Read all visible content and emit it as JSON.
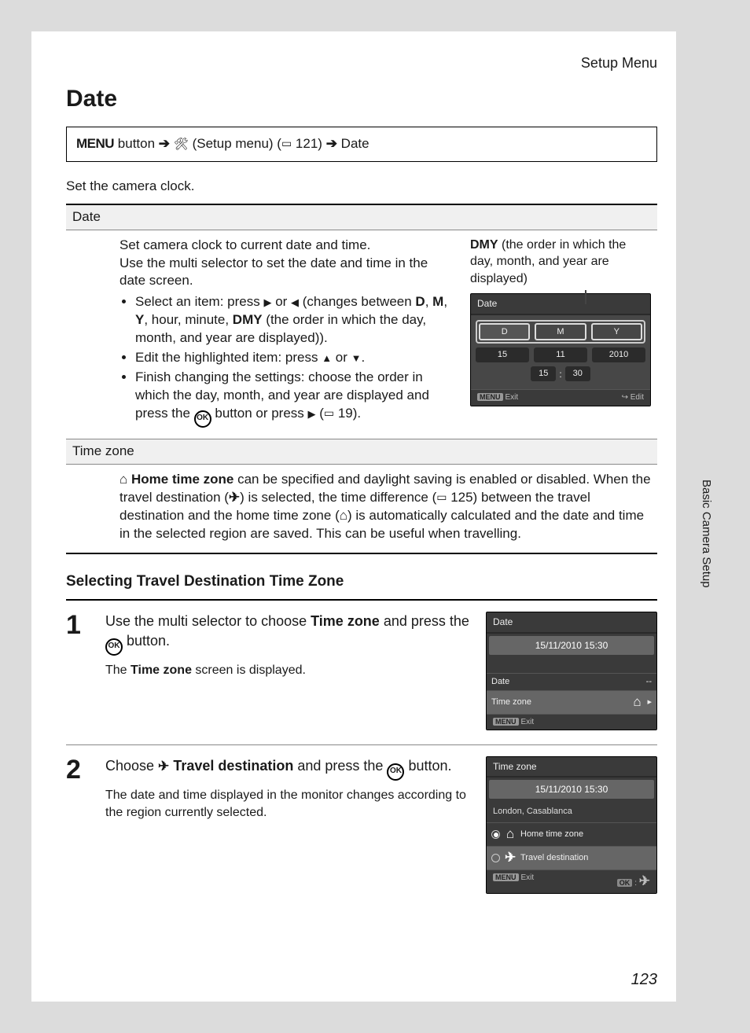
{
  "page": {
    "heading": "Setup Menu",
    "title": "Date",
    "sideTab": "Basic Camera Setup",
    "number": "123"
  },
  "breadcrumb": {
    "menu": "MENU",
    "b1": "button",
    "setup": "(Setup menu)",
    "ref": "121)",
    "end": "Date"
  },
  "intro": "Set the camera clock.",
  "row1": {
    "header": "Date",
    "p1": "Set camera clock to current date and time.",
    "p2": "Use the multi selector to set the date and time in the date screen.",
    "li1a": "Select an item: press ",
    "li1b": " or ",
    "li1c": " (changes between ",
    "li1d": ", ",
    "li1e": ", ",
    "li1f": ", hour, minute, ",
    "li1g": " (the order in which the day, month, and year are displayed)).",
    "D": "D",
    "M": "M",
    "Y": "Y",
    "DMY": "DMY",
    "li2a": "Edit the highlighted item: press ",
    "li2b": " or ",
    "li2c": ".",
    "li3a": "Finish changing the settings: choose the order in which the day, month, and year are displayed and press the ",
    "li3b": " button or press ",
    "li3c": " (",
    "li3d": " 19).",
    "ok": "OK",
    "dmyCaption1": "DMY",
    "dmyCaption2": " (the order in which the day, month, and year are displayed)"
  },
  "lcdDate": {
    "title": "Date",
    "D": "D",
    "M": "M",
    "Y": "Y",
    "d": "15",
    "m": "11",
    "y": "2010",
    "hh": "15",
    "colon": ":",
    "mm": "30",
    "menu": "MENU",
    "exit": "Exit",
    "edit": "Edit"
  },
  "row2": {
    "header": "Time zone",
    "t1": "Home time zone",
    "t2": " can be specified and daylight saving is enabled or disabled. When the travel destination (",
    "t3": ") is selected, the time difference (",
    "t4": " 125) between the travel destination and the home time zone (",
    "t5": ") is automatically calculated and the date and time in the selected region are saved. This can be useful when travelling."
  },
  "subTitle": "Selecting Travel Destination Time Zone",
  "step1": {
    "num": "1",
    "l1a": "Use the multi selector to choose ",
    "l1b": "Time zone",
    "l1c": " and press the ",
    "l1d": " button.",
    "ok": "OK",
    "l2a": "The ",
    "l2b": "Time zone",
    "l2c": " screen is displayed."
  },
  "lcd1": {
    "title": "Date",
    "dt": "15/11/2010 15:30",
    "opt1": "Date",
    "opt1v": "--",
    "opt2": "Time zone",
    "menu": "MENU",
    "exit": "Exit"
  },
  "step2": {
    "num": "2",
    "l1a": "Choose ",
    "l1b": "Travel destination",
    "l1c": " and press the ",
    "l1d": " button.",
    "ok": "OK",
    "l2": "The date and time displayed in the monitor changes according to the region currently selected."
  },
  "lcd2": {
    "title": "Time zone",
    "dt": "15/11/2010 15:30",
    "tz": "London, Casablanca",
    "opt1": "Home time zone",
    "opt2": "Travel destination",
    "menu": "MENU",
    "exit": "Exit",
    "ok": "OK"
  }
}
